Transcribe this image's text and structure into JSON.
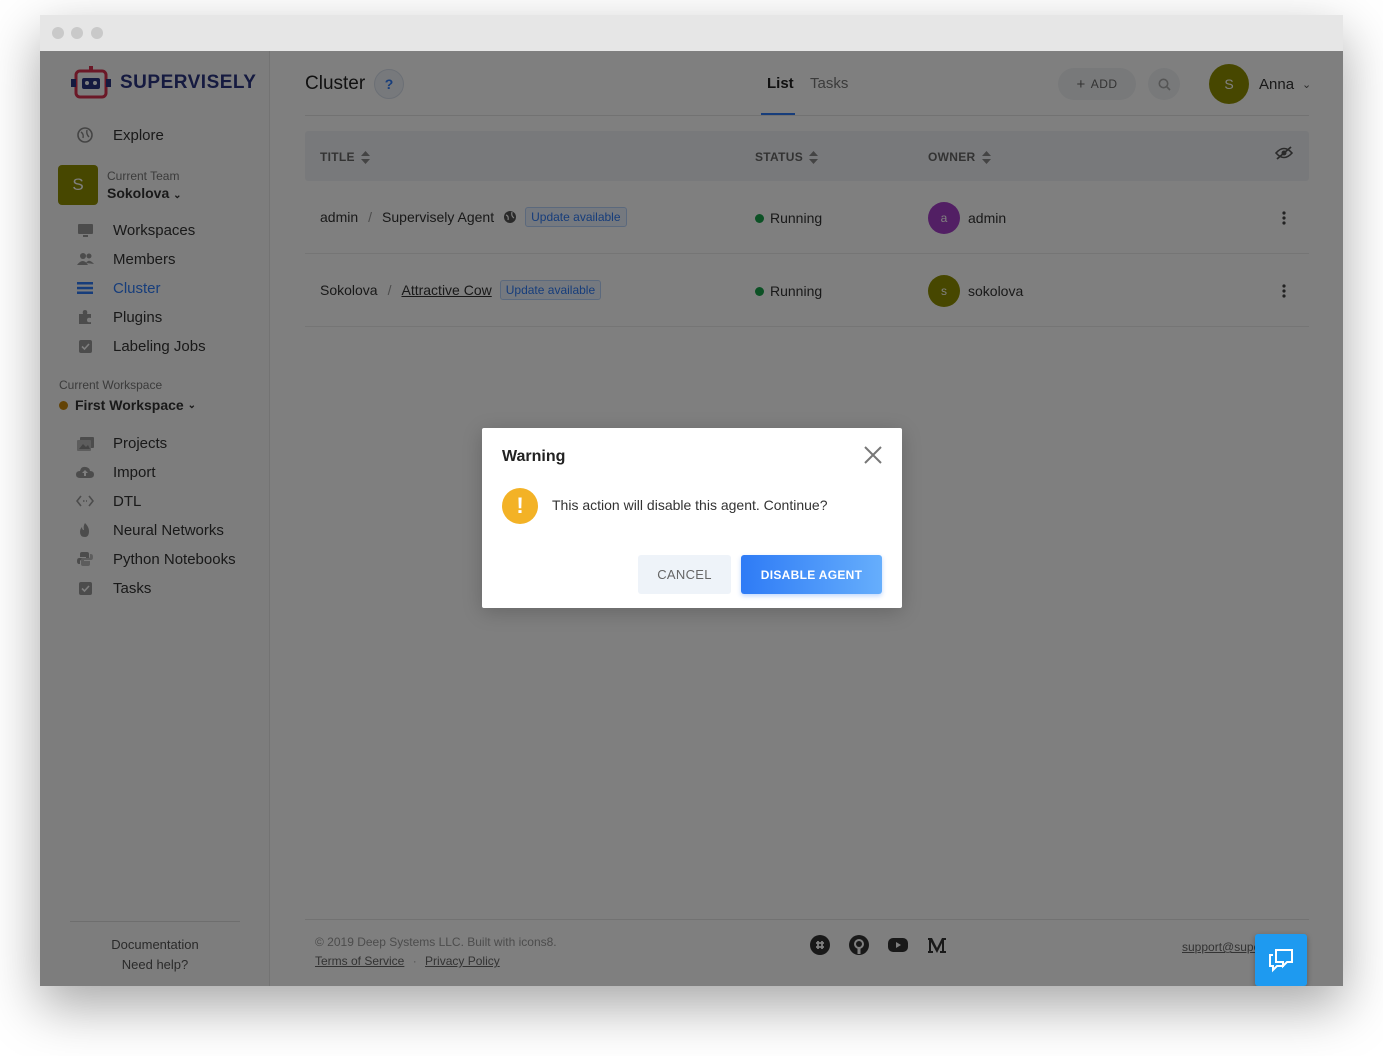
{
  "brand": {
    "name": "SUPERVISELY"
  },
  "sidebar": {
    "explore": "Explore",
    "team_label": "Current Team",
    "team_name": "Sokolova",
    "team_avatar": "S",
    "team_items": [
      {
        "label": "Workspaces",
        "icon": "monitor-icon"
      },
      {
        "label": "Members",
        "icon": "members-icon"
      },
      {
        "label": "Cluster",
        "icon": "list-icon",
        "active": true
      },
      {
        "label": "Plugins",
        "icon": "puzzle-icon"
      },
      {
        "label": "Labeling Jobs",
        "icon": "checkbox-icon"
      }
    ],
    "workspace_label": "Current Workspace",
    "workspace_name": "First Workspace",
    "workspace_items": [
      {
        "label": "Projects",
        "icon": "images-icon"
      },
      {
        "label": "Import",
        "icon": "cloud-upload-icon"
      },
      {
        "label": "DTL",
        "icon": "code-icon"
      },
      {
        "label": "Neural Networks",
        "icon": "flame-icon"
      },
      {
        "label": "Python Notebooks",
        "icon": "python-icon"
      },
      {
        "label": "Tasks",
        "icon": "checkbox-icon"
      }
    ],
    "footer": {
      "documentation": "Documentation",
      "help": "Need help?"
    }
  },
  "header": {
    "title": "Cluster",
    "help": "?",
    "tabs": [
      "List",
      "Tasks"
    ],
    "add_label": "ADD",
    "user_name": "Anna",
    "user_avatar": "S"
  },
  "table": {
    "columns": [
      "TITLE",
      "STATUS",
      "OWNER"
    ],
    "rows": [
      {
        "team": "admin",
        "agent": "Supervisely Agent",
        "badge": "Update available",
        "status": "Running",
        "owner": "admin",
        "owner_avatar": "a",
        "owner_color": "#a43fc8"
      },
      {
        "team": "Sokolova",
        "agent": "Attractive Cow",
        "badge": "Update available",
        "status": "Running",
        "owner": "sokolova",
        "owner_avatar": "s",
        "owner_color": "#8f8f00"
      }
    ]
  },
  "footer": {
    "copyright": "© 2019 Deep Systems LLC. Built with icons8.",
    "terms": "Terms of Service",
    "separator": "·",
    "privacy": "Privacy Policy",
    "support": "support@supervisely"
  },
  "modal": {
    "title": "Warning",
    "message": "This action will disable this agent. Continue?",
    "cancel": "CANCEL",
    "confirm": "DISABLE AGENT"
  },
  "colors": {
    "accent": "#2e7bf6",
    "warning": "#f3b226",
    "running": "#19a34a",
    "chat": "#1e9af0"
  }
}
